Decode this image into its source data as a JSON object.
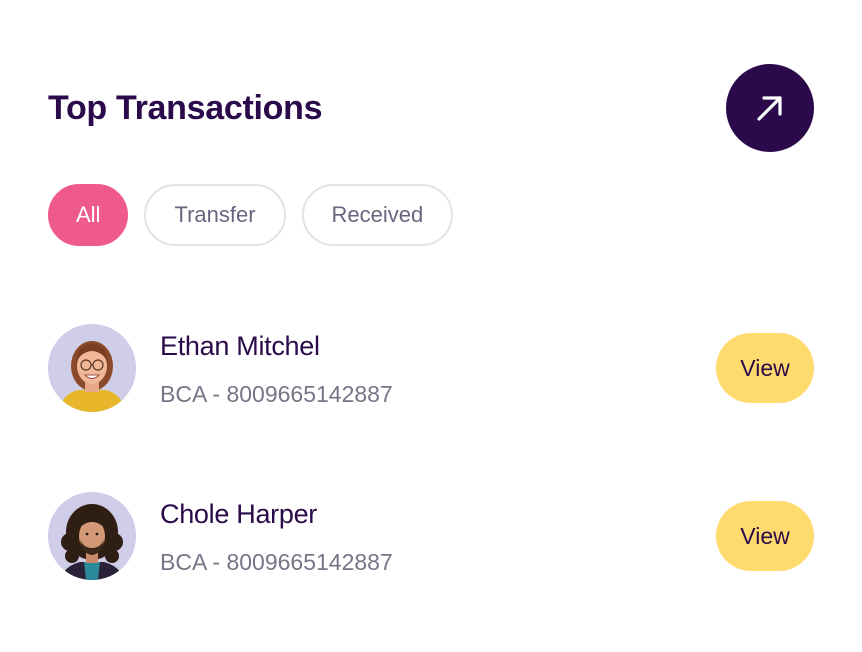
{
  "header": {
    "title": "Top Transactions",
    "expand_icon": "arrow-up-right-icon"
  },
  "filters": [
    {
      "label": "All",
      "active": true
    },
    {
      "label": "Transfer",
      "active": false
    },
    {
      "label": "Received",
      "active": false
    }
  ],
  "transactions": [
    {
      "name": "Ethan Mitchel",
      "account": "BCA - 8009665142887",
      "action": "View"
    },
    {
      "name": "Chole Harper",
      "account": "BCA - 8009665142887",
      "action": "View"
    }
  ],
  "colors": {
    "primary": "#2a0a4a",
    "accent_pink": "#ef5a8e",
    "button_yellow": "#ffdb6e",
    "avatar_bg": "#cfcde8"
  }
}
